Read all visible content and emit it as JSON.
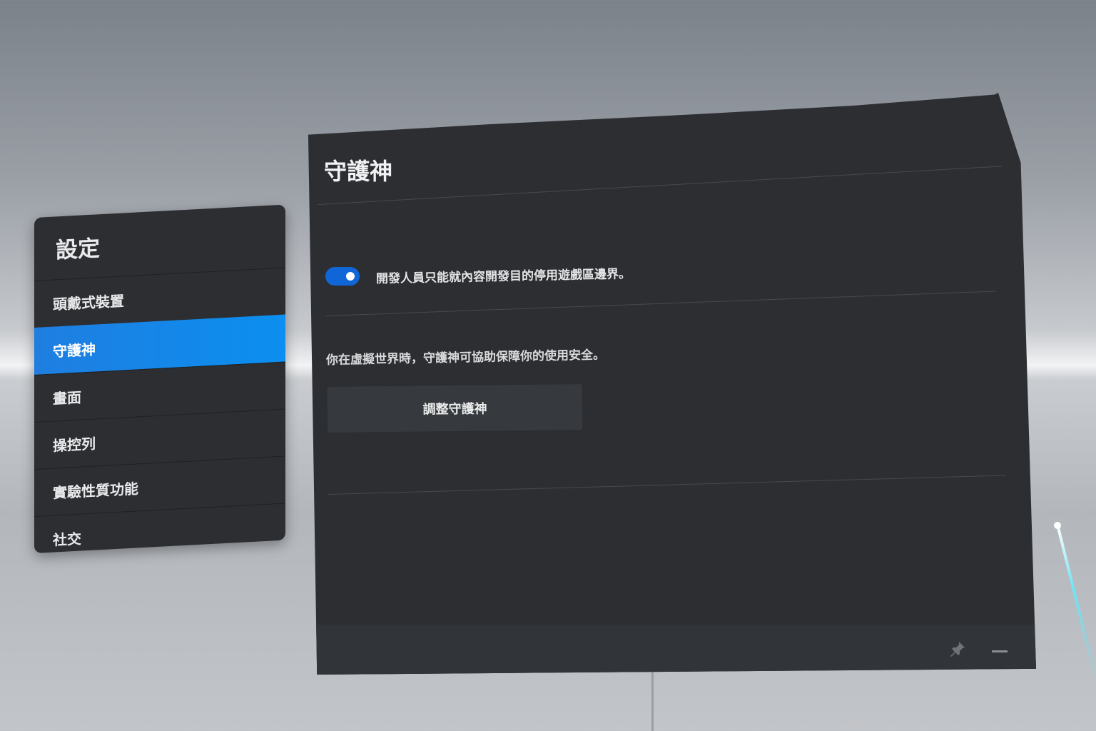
{
  "settings_menu": {
    "title": "設定",
    "items": [
      {
        "label": "頭戴式裝置",
        "active": false
      },
      {
        "label": "守護神",
        "active": true
      },
      {
        "label": "畫面",
        "active": false
      },
      {
        "label": "操控列",
        "active": false
      },
      {
        "label": "實驗性質功能",
        "active": false
      },
      {
        "label": "社交",
        "active": false
      }
    ]
  },
  "guardian_panel": {
    "title": "守護神",
    "toggle": {
      "on": true,
      "label": "開發人員只能就內容開發目的停用遊戲區邊界。"
    },
    "description": "你在虛擬世界時，守護神可協助保障你的使用安全。",
    "adjust_button": "調整守護神"
  },
  "footer_icons": [
    "pin-icon",
    "minimize-icon"
  ],
  "colors": {
    "accent": "#0b8ff0",
    "toggle": "#1066d6",
    "panel": "#2c2e32"
  }
}
